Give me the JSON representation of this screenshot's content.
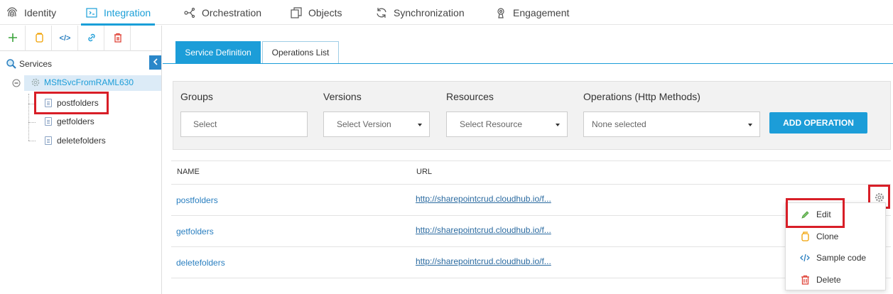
{
  "nav": {
    "items": [
      {
        "label": "Identity",
        "icon": "fingerprint-icon"
      },
      {
        "label": "Integration",
        "icon": "integration-icon",
        "active": true
      },
      {
        "label": "Orchestration",
        "icon": "orchestration-icon"
      },
      {
        "label": "Objects",
        "icon": "objects-icon"
      },
      {
        "label": "Synchronization",
        "icon": "sync-icon"
      },
      {
        "label": "Engagement",
        "icon": "engagement-icon"
      }
    ]
  },
  "sidebar": {
    "toolbar": {
      "add_icon": "plus-icon",
      "copy_icon": "copy-icon",
      "code_icon": "code-icon",
      "link_icon": "link-icon",
      "delete_icon": "trash-icon",
      "code_glyph": "</>"
    },
    "tree": {
      "root_label": "Services",
      "service_label": "MSftSvcFromRAML630",
      "operations": [
        "postfolders",
        "getfolders",
        "deletefolders"
      ]
    }
  },
  "tabs": {
    "service_definition": "Service Definition",
    "operations_list": "Operations List"
  },
  "filters": {
    "groups_label": "Groups",
    "groups_placeholder": "Select",
    "versions_label": "Versions",
    "versions_value": "Select Version",
    "resources_label": "Resources",
    "resources_value": "Select Resource",
    "operations_label": "Operations (Http Methods)",
    "operations_value": "None selected",
    "add_button": "ADD OPERATION"
  },
  "table": {
    "headers": {
      "name": "NAME",
      "url": "URL"
    },
    "rows": [
      {
        "name": "postfolders",
        "url": "http://sharepointcrud.cloudhub.io/f..."
      },
      {
        "name": "getfolders",
        "url": "http://sharepointcrud.cloudhub.io/f..."
      },
      {
        "name": "deletefolders",
        "url": "http://sharepointcrud.cloudhub.io/f..."
      }
    ]
  },
  "context_menu": {
    "items": [
      {
        "label": "Edit",
        "icon": "pencil-icon"
      },
      {
        "label": "Clone",
        "icon": "copy-icon"
      },
      {
        "label": "Sample code",
        "icon": "code-icon"
      },
      {
        "label": "Delete",
        "icon": "trash-icon"
      }
    ]
  },
  "colors": {
    "accent": "#1c9dd8",
    "highlight": "#d81e27"
  }
}
